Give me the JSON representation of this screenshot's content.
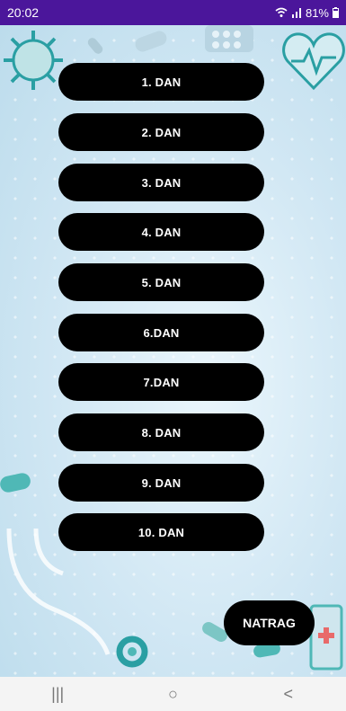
{
  "status_bar": {
    "time": "20:02",
    "battery": "81%"
  },
  "days": [
    "1. DAN",
    "2. DAN",
    "3. DAN",
    "4. DAN",
    "5. DAN",
    "6.DAN",
    "7.DAN",
    "8. DAN",
    "9. DAN",
    "10. DAN"
  ],
  "back_label": "NATRAG",
  "nav": {
    "recents": "|||",
    "home": "○",
    "back": "<"
  },
  "colors": {
    "status_bar": "#4b169b",
    "button": "#000000",
    "button_text": "#ffffff",
    "background": "#dfeef7"
  },
  "icons": [
    "wifi-icon",
    "signal-icon",
    "battery-icon",
    "virus-icon",
    "heart-pulse-icon",
    "pill-icon",
    "stethoscope-icon"
  ]
}
